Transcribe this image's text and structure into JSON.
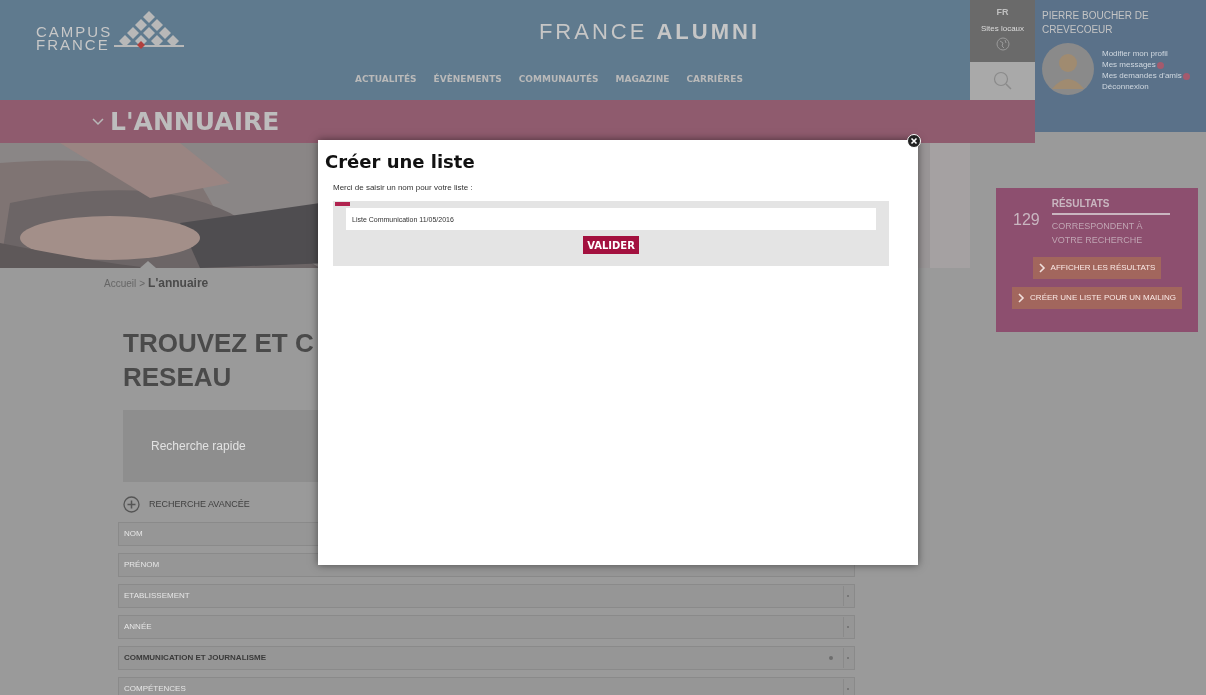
{
  "header": {
    "logo": [
      "CAMPUS",
      "FRANCE"
    ],
    "site_title": {
      "light": "FRANCE",
      "bold": "ALUMNI"
    },
    "nav": [
      "ACTUALITÉS",
      "ÉVÈNEMENTS",
      "COMMUNAUTÉS",
      "MAGAZINE",
      "CARRIÈRES"
    ],
    "language": "FR",
    "local_sites": "Sites locaux"
  },
  "user": {
    "name": "PIERRE BOUCHER DE CREVECOEUR",
    "links": [
      {
        "label": "Modifier mon profil",
        "notification": false
      },
      {
        "label": "Mes messages",
        "notification": true
      },
      {
        "label": "Mes demandes d'amis",
        "notification": true
      },
      {
        "label": "Déconnexion",
        "notification": false
      }
    ]
  },
  "section_title": "L'ANNUAIRE",
  "breadcrumb": {
    "parent": "Accueil",
    "separator": ">",
    "current": "L'annuaire"
  },
  "heading": [
    "TROUVEZ ET C",
    "RESEAU"
  ],
  "quick_search": {
    "placeholder": "Recherche rapide"
  },
  "advanced_search": "RECHERCHE AVANCÉE",
  "fields": [
    {
      "label": "NOM",
      "filled": false,
      "dropdown": false,
      "clearable": false
    },
    {
      "label": "PRÉNOM",
      "filled": false,
      "dropdown": false,
      "clearable": false
    },
    {
      "label": "ETABLISSEMENT",
      "filled": false,
      "dropdown": true,
      "clearable": false
    },
    {
      "label": "ANNÉE",
      "filled": false,
      "dropdown": true,
      "clearable": false
    },
    {
      "label": "COMMUNICATION ET JOURNALISME",
      "filled": true,
      "dropdown": true,
      "clearable": true
    },
    {
      "label": "COMPÉTENCES",
      "filled": false,
      "dropdown": true,
      "clearable": false
    }
  ],
  "results": {
    "count": "129",
    "title": "RÉSULTATS",
    "subtitle": "CORRESPONDENT À VOTRE RECHERCHE",
    "buttons": [
      "AFFICHER LES RÉSULTATS",
      "CRÉER UNE LISTE POUR UN MAILING"
    ]
  },
  "modal": {
    "title": "Créer une liste",
    "prompt": "Merci de saisir un nom pour votre liste :",
    "value": "Liste Communication 11/05/2016",
    "submit": "VALIDER"
  }
}
